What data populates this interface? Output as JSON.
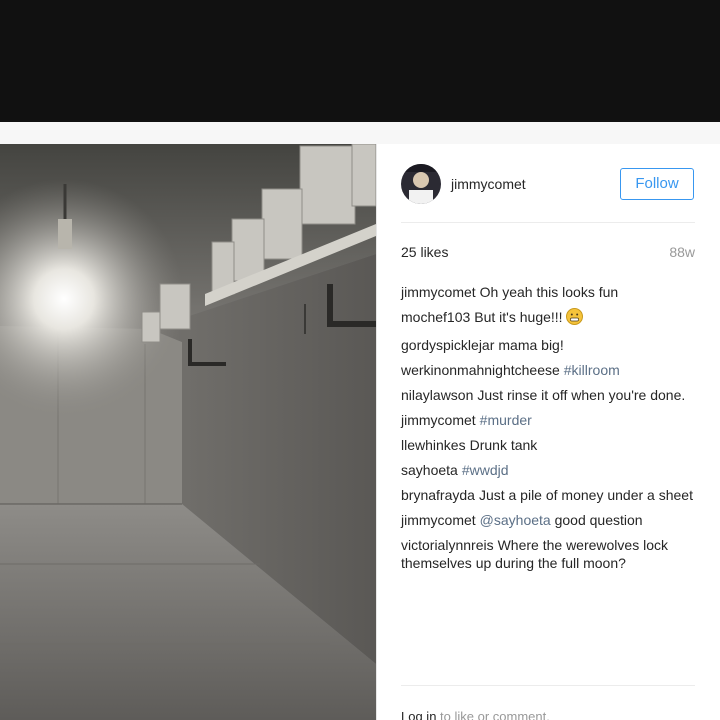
{
  "post": {
    "author": "jimmycomet",
    "follow_label": "Follow",
    "likes": "25 likes",
    "age": "88w"
  },
  "comments": [
    {
      "user": "jimmycomet",
      "text": "Oh yeah this looks fun",
      "hashtag": ""
    },
    {
      "user": "mochef103",
      "text": "But it's huge!!! ",
      "hashtag": ""
    },
    {
      "user": "gordyspicklejar",
      "text": "mama big!",
      "hashtag": ""
    },
    {
      "user": "werkinonmahnightcheese",
      "text": "",
      "hashtag": "#killroom"
    },
    {
      "user": "nilaylawson",
      "text": "Just rinse it off when you're done.",
      "hashtag": ""
    },
    {
      "user": "jimmycomet",
      "text": "",
      "hashtag": "#murder"
    },
    {
      "user": "llewhinkes",
      "text": "Drunk tank",
      "hashtag": ""
    },
    {
      "user": "sayhoeta",
      "text": "",
      "hashtag": "#wwdjd"
    },
    {
      "user": "brynafrayda",
      "text": "Just a pile of money under a sheet",
      "hashtag": ""
    },
    {
      "user": "jimmycomet",
      "text": " good question",
      "hashtag": "@sayhoeta"
    },
    {
      "user": "victorialynnreis",
      "text": "Where the werewolves lock themselves up during the full moon?",
      "hashtag": ""
    }
  ],
  "footer": {
    "login_link": "Log in",
    "login_rest": "to like or comment.",
    "more_icon": "..."
  },
  "icons": {
    "avatar": "avatar-photo",
    "emoji": "grimacing-face-icon"
  },
  "colors": {
    "accent": "#3897f0",
    "hashtag": "#5b6f86",
    "muted": "#999999"
  }
}
